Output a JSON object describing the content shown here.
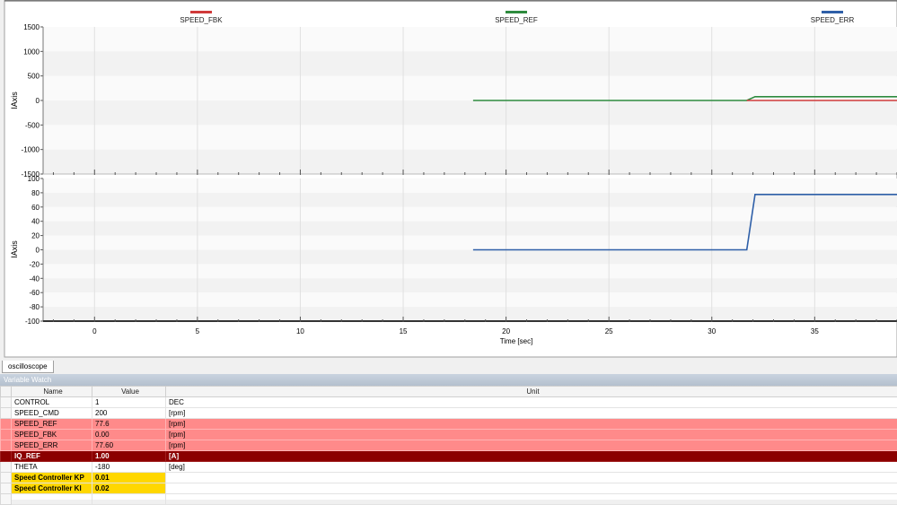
{
  "scope": {
    "legend": [
      {
        "name": "SPEED_FBK",
        "color": "#d03a3a"
      },
      {
        "name": "SPEED_REF",
        "color": "#2e8b3e"
      },
      {
        "name": "SPEED_ERR",
        "color": "#2e5fa8"
      }
    ],
    "top_ylabel": "IAxis",
    "bottom_ylabel": "IAxis",
    "xlabel": "Time [sec]"
  },
  "chart_data": [
    {
      "type": "line",
      "ylabel": "IAxis",
      "ylim": [
        -1500,
        1500
      ],
      "xlim": [
        -2.5,
        39
      ],
      "yticks": [
        "1500",
        "1000",
        "500",
        "0",
        "-500",
        "-1000",
        "-1500"
      ],
      "grid": true,
      "series": [
        {
          "name": "SPEED_REF",
          "color": "#2e8b3e",
          "x": [
            18.4,
            31.7,
            32.1,
            39
          ],
          "y": [
            0,
            0,
            77.6,
            77.6
          ]
        },
        {
          "name": "SPEED_FBK",
          "color": "#d03a3a",
          "x": [
            31.7,
            39
          ],
          "y": [
            0,
            0
          ]
        }
      ]
    },
    {
      "type": "line",
      "ylabel": "IAxis",
      "xlabel": "Time [sec]",
      "ylim": [
        -100,
        100
      ],
      "xlim": [
        -2.5,
        39
      ],
      "yticks": [
        "100",
        "80",
        "60",
        "40",
        "20",
        "0",
        "-20",
        "-40",
        "-60",
        "-80",
        "-100"
      ],
      "xticks": [
        "0",
        "5",
        "10",
        "15",
        "20",
        "25",
        "30",
        "35"
      ],
      "grid": true,
      "series": [
        {
          "name": "SPEED_ERR",
          "color": "#2e5fa8",
          "x": [
            18.4,
            31.7,
            32.1,
            39
          ],
          "y": [
            0,
            0,
            77.6,
            77.6
          ]
        }
      ]
    }
  ],
  "tab": {
    "label": "oscilloscope"
  },
  "watch": {
    "title": "Variable Watch",
    "headers": {
      "name": "Name",
      "value": "Value",
      "unit": "Unit"
    },
    "rows": [
      {
        "name": "CONTROL",
        "value": "1",
        "unit": "DEC"
      },
      {
        "name": "SPEED_CMD",
        "value": "200",
        "unit": "[rpm]"
      },
      {
        "name": "SPEED_REF",
        "value": "77.6",
        "unit": "[rpm]"
      },
      {
        "name": "SPEED_FBK",
        "value": "0.00",
        "unit": "[rpm]"
      },
      {
        "name": "SPEED_ERR",
        "value": "77.60",
        "unit": "[rpm]"
      },
      {
        "name": "IQ_REF",
        "value": "1.00",
        "unit": "[A]"
      },
      {
        "name": "THETA",
        "value": "-180",
        "unit": "[deg]"
      },
      {
        "name": "Speed Controller KP",
        "value": "0.01",
        "unit": ""
      },
      {
        "name": "Speed Controller KI",
        "value": "0.02",
        "unit": ""
      }
    ],
    "colors": {
      "pink": "#ff8a8a",
      "dark": "#8b0000",
      "gold": "#ffd700"
    }
  }
}
